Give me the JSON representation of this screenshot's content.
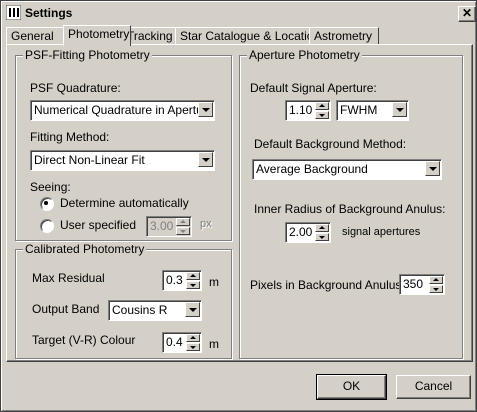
{
  "window": {
    "title": "Settings",
    "close_symbol": "✕"
  },
  "tabs": [
    "General",
    "Photometry",
    "Tracking",
    "Star Catalogue & Location",
    "Astrometry"
  ],
  "active_tab": "Photometry",
  "psf": {
    "group_title": "PSF-Fitting Photometry",
    "quadrature_label": "PSF Quadrature:",
    "quadrature_value": "Numerical Quadrature in Aperture",
    "method_label": "Fitting Method:",
    "method_value": "Direct Non-Linear Fit",
    "seeing_label": "Seeing:",
    "seeing_auto_label": "Determine automatically",
    "seeing_user_label": "User specified",
    "seeing_selected": "auto",
    "seeing_value": "3.00",
    "seeing_unit": "px"
  },
  "calibrated": {
    "group_title": "Calibrated Photometry",
    "max_residual_label": "Max Residual",
    "max_residual_value": "0.3",
    "max_residual_unit": "m",
    "output_band_label": "Output Band",
    "output_band_value": "Cousins R",
    "target_colour_label": "Target (V-R) Colour",
    "target_colour_value": "0.4",
    "target_colour_unit": "m"
  },
  "aperture": {
    "group_title": "Aperture Photometry",
    "signal_label": "Default Signal Aperture:",
    "signal_value": "1.10",
    "signal_unit": "FWHM",
    "background_method_label": "Default Background Method:",
    "background_method_value": "Average Background",
    "inner_radius_label": "Inner Radius of Background Anulus:",
    "inner_radius_value": "2.00",
    "inner_radius_unit": "signal apertures",
    "pixels_label": "Pixels in Background Anulus:",
    "pixels_value": "350"
  },
  "buttons": {
    "ok": "OK",
    "cancel": "Cancel"
  }
}
